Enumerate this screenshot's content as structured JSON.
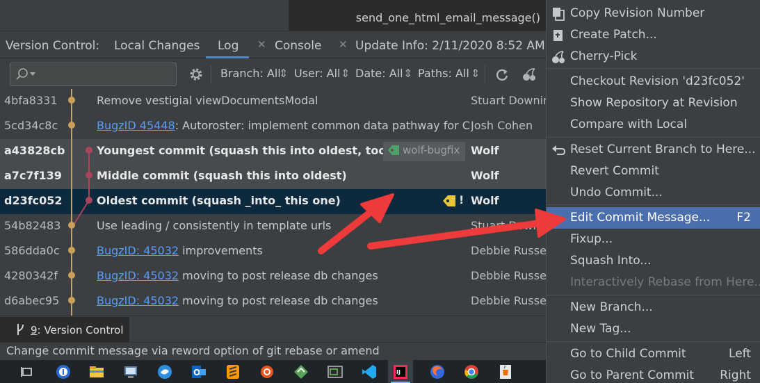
{
  "editor": {
    "open_tab": "send_one_html_email_message()"
  },
  "tabs": {
    "title": "Version Control:",
    "items": [
      {
        "label": "Local Changes"
      },
      {
        "label": "Log"
      },
      {
        "label": "Console"
      },
      {
        "label": "Update Info: 2/11/2020 8:52 AM"
      }
    ]
  },
  "toolbar": {
    "search_placeholder": "",
    "filters": [
      {
        "label": "Branch: All"
      },
      {
        "label": "User: All"
      },
      {
        "label": "Date: All"
      },
      {
        "label": "Paths: All"
      }
    ]
  },
  "commits": [
    {
      "hash": "4bfa8331",
      "link": "",
      "message": "Remove vestigial viewDocumentsModal",
      "author": "Stuart Downing",
      "style": "normal"
    },
    {
      "hash": "5cd34c8c",
      "link": "BugzID 45448",
      "message": ": Autoroster: implement common data pathway for C",
      "author": "Josh Cohen",
      "style": "normal"
    },
    {
      "hash": "a43828cb",
      "link": "",
      "message": "Youngest commit (squash this into oldest, too)",
      "author": "Wolf",
      "style": "bold",
      "tag": "wolf-bugfix"
    },
    {
      "hash": "a7c7f139",
      "link": "",
      "message": "Middle commit (squash this into oldest)",
      "author": "Wolf",
      "style": "bold"
    },
    {
      "hash": "d23fc052",
      "link": "",
      "message": "Oldest commit (squash _into_ this one)",
      "author": "Wolf",
      "style": "selected",
      "marker": "!"
    },
    {
      "hash": "54b82483",
      "link": "",
      "message": "Use leading / consistently in template urls",
      "author": "Stuart Downing",
      "style": "normal"
    },
    {
      "hash": "586dda0c",
      "link": "BugzID: 45032",
      "message": " improvements",
      "author": "Debbie Russell",
      "style": "normal"
    },
    {
      "hash": "4280342f",
      "link": "BugzID: 45032",
      "message": " moving to post release db changes",
      "author": "Debbie Russell",
      "style": "normal"
    },
    {
      "hash": "d6abec95",
      "link": "BugzID: 45032",
      "message": " moving to post release db changes",
      "author": "Debbie Russell",
      "style": "normal"
    }
  ],
  "bottom": {
    "vc_tab_number": "9",
    "vc_tab_label": ": Version Control",
    "status": "Change commit message via reword option of git rebase or amend"
  },
  "menu": {
    "items": [
      {
        "label": "Copy Revision Number",
        "icon": "copy-icon"
      },
      {
        "label": "Create Patch...",
        "icon": "patch-icon"
      },
      {
        "label": "Cherry-Pick",
        "icon": "cherry-icon"
      },
      {
        "sep": true
      },
      {
        "label": "Checkout Revision 'd23fc052'"
      },
      {
        "label": "Show Repository at Revision"
      },
      {
        "label": "Compare with Local"
      },
      {
        "sep": true
      },
      {
        "label": "Reset Current Branch to Here...",
        "icon": "undo-icon"
      },
      {
        "label": "Revert Commit"
      },
      {
        "label": "Undo Commit..."
      },
      {
        "sep": true
      },
      {
        "label": "Edit Commit Message...",
        "shortcut": "F2",
        "highlighted": true
      },
      {
        "label": "Fixup..."
      },
      {
        "label": "Squash Into..."
      },
      {
        "label": "Interactively Rebase from Here...",
        "disabled": true
      },
      {
        "sep": true
      },
      {
        "label": "New Branch..."
      },
      {
        "label": "New Tag..."
      },
      {
        "sep": true
      },
      {
        "label": "Go to Child Commit",
        "shortcut": "Left"
      },
      {
        "label": "Go to Parent Commit",
        "shortcut": "Right"
      }
    ]
  },
  "colors": {
    "accent": "#4b6eaf",
    "link": "#589df6",
    "selection": "#0d293e",
    "graph_main": "#c9a15a",
    "graph_branch": "#a8455d",
    "annotation_arrow": "#ee3a3a"
  }
}
